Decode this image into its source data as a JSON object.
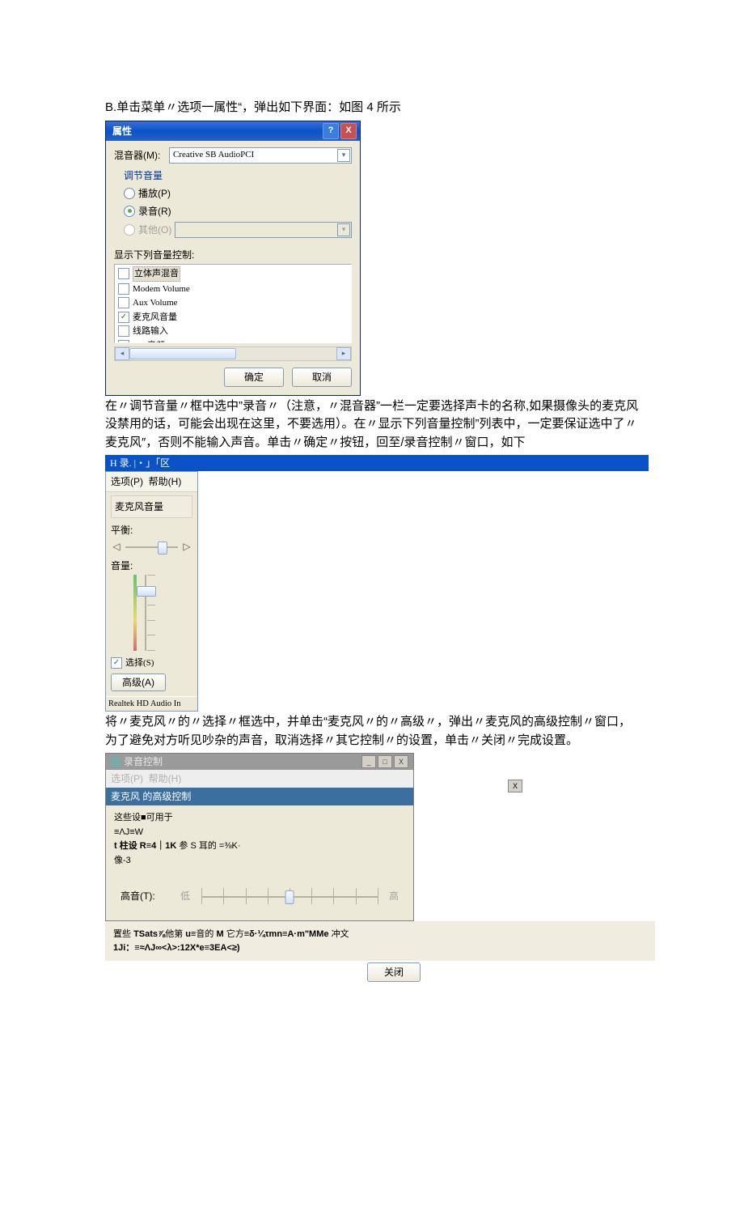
{
  "para1_prefix": "B.",
  "para1": "单击菜单〃选项一属性“，弹出如下界面：如图 4 所示",
  "dlg1": {
    "title": "属性",
    "mixer_label": "混音器(M):",
    "mixer_value": "Creative SB AudioPCI",
    "adjust_label": "调节音量",
    "radio_play": "播放(P)",
    "radio_rec": "录音(R)",
    "radio_other": "其他(O)",
    "list_label": "显示下列音量控制:",
    "items": {
      "i0": "立体声混音",
      "i1": "Modem Volume",
      "i2": "Aux Volume",
      "i3": "麦克风音量",
      "i4": "线路输入",
      "i5": "CD 音频"
    },
    "ok": "确定",
    "cancel": "取消"
  },
  "para2": "在〃调节音量〃框中选中”录音〃（注意，〃混音器”一栏一定要选择声卡的名称,如果摄像头的麦克风没禁用的话，可能会出现在这里，不要选用）。在〃显示下列音量控制”列表中，一定要保证选中了〃麦克风″，否则不能输入声音。单击〃确定〃按钮，回至/录音控制〃窗口，如下",
  "bluebar": "H 录. |・」「区",
  "rec": {
    "menu_opt": "选项(P)",
    "menu_help": "帮助(H)",
    "header": "麦克风音量",
    "balance": "平衡:",
    "volume": "音量:",
    "select": "选择(S)",
    "adv": "高级(A)",
    "status": "Realtek HD Audio In"
  },
  "para3": "将〃麦克风〃的〃选择〃框选中，并单击“麦克风〃的〃高级〃，弹出〃麦克风的高级控制〃窗口，为了避免对方听见吵杂的声音，取消选择〃其它控制〃的设置，单击〃关闭〃完成设置。",
  "d3": {
    "title": "录音控制",
    "menu_opt": "选项(P)",
    "menu_help": "帮助(H)",
    "sub": "麦克风 的高级控制",
    "l1": "这些设■可用于",
    "l2": "≡ΛJ≡W",
    "l3a": "t 柱设 ",
    "l3b": "R≡4｜1K ",
    "l3c": "参 S 耳的 =⅜K·",
    "l4": "像-3",
    "treble_label": "高音(T):",
    "low": "低",
    "high": "高",
    "other1a": "置些 ",
    "other1b": "TSats⅞",
    "other1c": "他第 ",
    "other1d": "u≡",
    "other1e": "音的 ",
    "other1f": "M ",
    "other1g": "它方",
    "other1h": "≡δ·¼τmn≡A·m\"MMe ",
    "other1i": "冲文",
    "other2a": "1Ji：≡≈ΛJ∞<λ>:12X*e≡3EA<≥)",
    "close": "关闭"
  }
}
